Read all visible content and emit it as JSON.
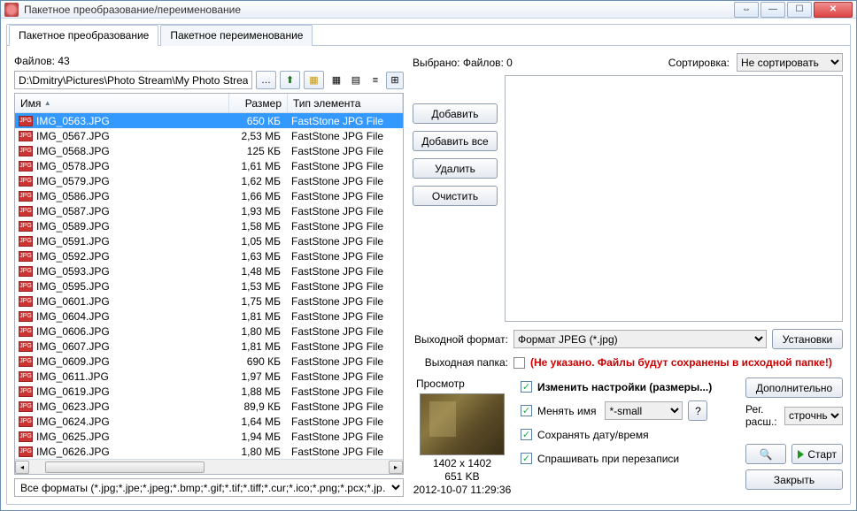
{
  "window": {
    "title": "Пакетное преобразование/переименование"
  },
  "tabs": [
    "Пакетное преобразование",
    "Пакетное переименование"
  ],
  "active_tab": 0,
  "file_count_label": "Файлов: 43",
  "path": "D:\\Dmitry\\Pictures\\Photo Stream\\My Photo Stream\\",
  "columns": {
    "name": "Имя",
    "size": "Размер",
    "type": "Тип элемента"
  },
  "files": [
    {
      "name": "IMG_0563.JPG",
      "size": "650 КБ",
      "type": "FastStone JPG File",
      "selected": true
    },
    {
      "name": "IMG_0567.JPG",
      "size": "2,53 МБ",
      "type": "FastStone JPG File"
    },
    {
      "name": "IMG_0568.JPG",
      "size": "125 КБ",
      "type": "FastStone JPG File"
    },
    {
      "name": "IMG_0578.JPG",
      "size": "1,61 МБ",
      "type": "FastStone JPG File"
    },
    {
      "name": "IMG_0579.JPG",
      "size": "1,62 МБ",
      "type": "FastStone JPG File"
    },
    {
      "name": "IMG_0586.JPG",
      "size": "1,66 МБ",
      "type": "FastStone JPG File"
    },
    {
      "name": "IMG_0587.JPG",
      "size": "1,93 МБ",
      "type": "FastStone JPG File"
    },
    {
      "name": "IMG_0589.JPG",
      "size": "1,58 МБ",
      "type": "FastStone JPG File"
    },
    {
      "name": "IMG_0591.JPG",
      "size": "1,05 МБ",
      "type": "FastStone JPG File"
    },
    {
      "name": "IMG_0592.JPG",
      "size": "1,63 МБ",
      "type": "FastStone JPG File"
    },
    {
      "name": "IMG_0593.JPG",
      "size": "1,48 МБ",
      "type": "FastStone JPG File"
    },
    {
      "name": "IMG_0595.JPG",
      "size": "1,53 МБ",
      "type": "FastStone JPG File"
    },
    {
      "name": "IMG_0601.JPG",
      "size": "1,75 МБ",
      "type": "FastStone JPG File"
    },
    {
      "name": "IMG_0604.JPG",
      "size": "1,81 МБ",
      "type": "FastStone JPG File"
    },
    {
      "name": "IMG_0606.JPG",
      "size": "1,80 МБ",
      "type": "FastStone JPG File"
    },
    {
      "name": "IMG_0607.JPG",
      "size": "1,81 МБ",
      "type": "FastStone JPG File"
    },
    {
      "name": "IMG_0609.JPG",
      "size": "690 КБ",
      "type": "FastStone JPG File"
    },
    {
      "name": "IMG_0611.JPG",
      "size": "1,97 МБ",
      "type": "FastStone JPG File"
    },
    {
      "name": "IMG_0619.JPG",
      "size": "1,88 МБ",
      "type": "FastStone JPG File"
    },
    {
      "name": "IMG_0623.JPG",
      "size": "89,9 КБ",
      "type": "FastStone JPG File"
    },
    {
      "name": "IMG_0624.JPG",
      "size": "1,64 МБ",
      "type": "FastStone JPG File"
    },
    {
      "name": "IMG_0625.JPG",
      "size": "1,94 МБ",
      "type": "FastStone JPG File"
    },
    {
      "name": "IMG_0626.JPG",
      "size": "1,80 МБ",
      "type": "FastStone JPG File"
    }
  ],
  "filter": "Все форматы (*.jpg;*.jpe;*.jpeg;*.bmp;*.gif;*.tif;*.tiff;*.cur;*.ico;*.png;*.pcx;*.jp…",
  "selected_label": "Выбрано:  Файлов: 0",
  "sort_label": "Сортировка:",
  "sort_value": "Не сортировать",
  "buttons": {
    "add": "Добавить",
    "add_all": "Добавить все",
    "remove": "Удалить",
    "clear": "Очистить",
    "settings": "Установки",
    "advanced": "Дополнительно",
    "start": "Старт",
    "close": "Закрыть",
    "help": "?"
  },
  "out_format_label": "Выходной формат:",
  "out_format_value": "Формат JPEG (*.jpg)",
  "out_folder_label": "Выходная папка:",
  "out_folder_warn": "(Не указано. Файлы будут сохранены в исходной папке!)",
  "preview_label": "Просмотр",
  "preview_meta": {
    "dims": "1402 x 1402",
    "size": "651 KB",
    "date": "2012-10-07 11:29:36"
  },
  "opts": {
    "change_settings": "Изменить настройки (размеры...)",
    "rename": "Менять имя",
    "rename_value": "*-small",
    "keep_date": "Сохранять дату/время",
    "ask_overwrite": "Спрашивать при перезаписи"
  },
  "ext_case_label": "Рег. расш.:",
  "ext_case_value": "строчны"
}
